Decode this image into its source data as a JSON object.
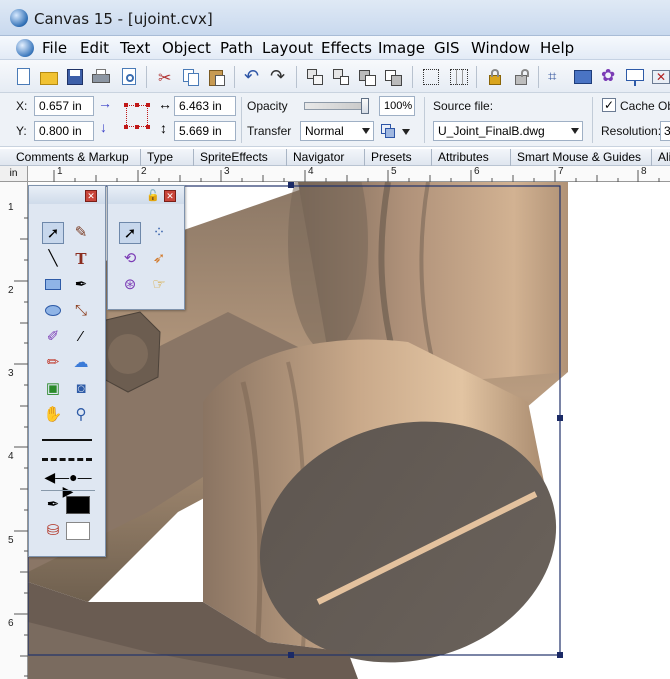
{
  "window": {
    "title": "Canvas 15 - [ujoint.cvx]"
  },
  "menu": [
    "File",
    "Edit",
    "Text",
    "Object",
    "Path",
    "Layout",
    "Effects",
    "Image",
    "GIS",
    "Window",
    "Help"
  ],
  "toolbar_icons": [
    "new-document-icon",
    "open-folder-icon",
    "save-icon",
    "print-icon",
    "print-preview-icon",
    "cut-icon",
    "copy-icon",
    "paste-icon",
    "undo-icon",
    "redo-icon",
    "group-icon",
    "ungroup-icon",
    "send-back-icon",
    "bring-front-icon",
    "align-icon",
    "distribute-icon",
    "lock-icon",
    "unlock-icon",
    "chart-icon",
    "slideshow-icon",
    "sprite-icon",
    "presentation-icon",
    "extra-icon"
  ],
  "properties": {
    "x_label": "X:",
    "x_value": "0.657 in",
    "y_label": "Y:",
    "y_value": "0.800 in",
    "width_value": "6.463 in",
    "height_value": "5.669 in",
    "opacity_label": "Opacity",
    "opacity_value": "100%",
    "opacity_level": 1.0,
    "transfer_label": "Transfer",
    "transfer_value": "Normal",
    "source_label": "Source file:",
    "source_value": "U_Joint_FinalB.dwg",
    "cache_label": "Cache Obj",
    "cache_checked": true,
    "resolution_label": "Resolution:",
    "resolution_value": "3"
  },
  "tabs": [
    "Comments & Markup",
    "Type",
    "SpriteEffects",
    "Navigator",
    "Presets",
    "Attributes",
    "Smart Mouse & Guides",
    "Alig"
  ],
  "ruler": {
    "unit": "in",
    "top_numbers": [
      "1",
      "2",
      "3",
      "4",
      "5",
      "6",
      "7",
      "8"
    ],
    "left_numbers": [
      "1",
      "2",
      "3",
      "4",
      "5",
      "6"
    ]
  },
  "toolbox_main": [
    "arrow-tool-icon",
    "brush-tool-icon",
    "line-tool-icon",
    "text-tool-icon",
    "rectangle-tool-icon",
    "pen-tool-icon",
    "oval-tool-icon",
    "dimension-tool-icon",
    "highlighter-tool-icon",
    "eyedropper-tool-icon",
    "marker-tool-icon",
    "ghost-tool-icon",
    "image-place-icon",
    "camera-tool-icon",
    "hand-tool-icon",
    "zoom-tool-icon"
  ],
  "toolbox_small": [
    "pointer-icon",
    "node-select-icon",
    "lasso-select-icon",
    "direct-select-icon",
    "lasso-plus-icon",
    "smart-mouse-icon"
  ],
  "colors": {
    "accent": "#1f4e9a",
    "pen": "#000000",
    "fill": "#ffffff",
    "object": "#c9a98a"
  }
}
